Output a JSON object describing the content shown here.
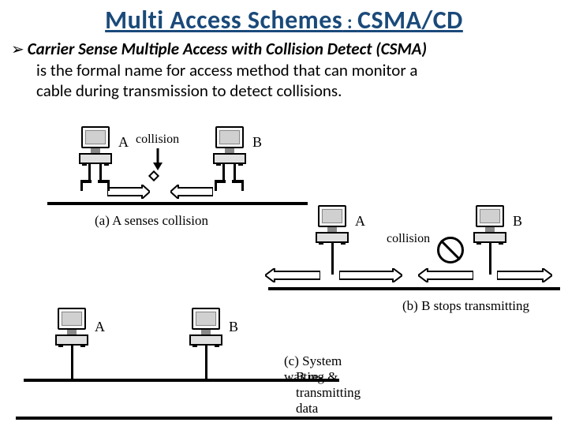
{
  "title_main": "Multi Access Schemes",
  "title_sep": " : ",
  "title_sub": "CSMA/CD",
  "bullet_glyph": "➢",
  "term": "Carrier Sense Multiple Access with Collision Detect (CSMA)",
  "definition_line1": "is the formal name for access method that can monitor a",
  "definition_line2": "cable during transmission to detect collisions.",
  "labels": {
    "A": "A",
    "B": "B",
    "collision": "collision"
  },
  "captions": {
    "a": "(a) A senses collision",
    "b": "(b) B stops transmitting",
    "c1": "(c) System waiting &",
    "c2": "B re-transmitting data"
  }
}
